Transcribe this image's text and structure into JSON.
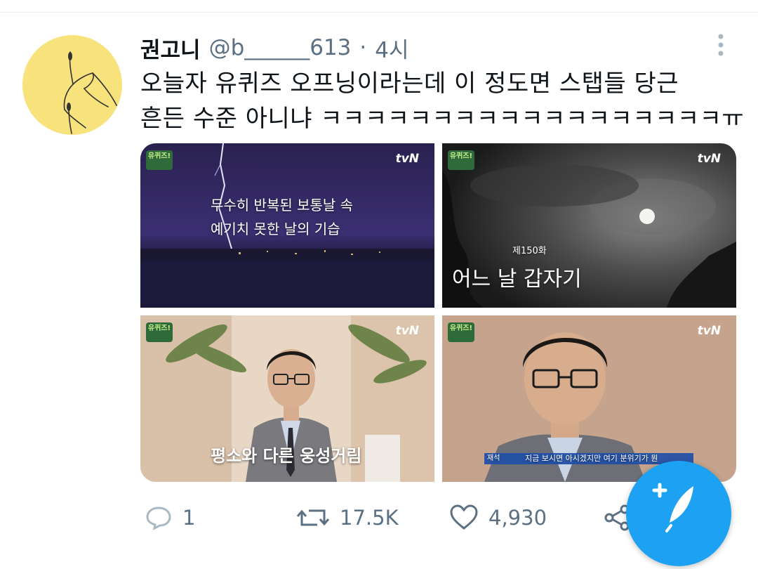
{
  "tweet": {
    "author_name": "권고니",
    "handle": "@b______613",
    "separator": "·",
    "time": "4시",
    "text_line1": "오늘자 유퀴즈 오프닝이라는데 이 정도면 스탭들 당근",
    "text_line2": "흔든 수준 아니냐 ㅋㅋㅋㅋㅋㅋㅋㅋㅋㅋㅋㅋㅋㅋㅋㅋㅋㅋㅠ"
  },
  "media": {
    "channel_badge": "tvN",
    "show_logo": "유퀴즈!",
    "tile1_caption_line1": "무수히 반복된 보통날 속",
    "tile1_caption_line2": "예기치 못한 날의 기습",
    "tile2_episode": "제150화",
    "tile2_title": "어느 날 갑자기",
    "tile3_caption": "평소와 다른 웅성거림",
    "tile4_subtitle_tag": "재석",
    "tile4_subtitle": "지금 보시면 아시겠지만 여기 분위기가 뭔"
  },
  "actions": {
    "reply_count": "1",
    "retweet_count": "17.5K",
    "like_count": "4,930"
  },
  "colors": {
    "accent": "#1da1f2",
    "secondary_text": "#5b7083",
    "avatar_bg": "#f7e27c"
  },
  "icons": [
    "more-vertical-icon",
    "reply-icon",
    "retweet-icon",
    "like-icon",
    "share-icon",
    "compose-tweet-icon"
  ]
}
